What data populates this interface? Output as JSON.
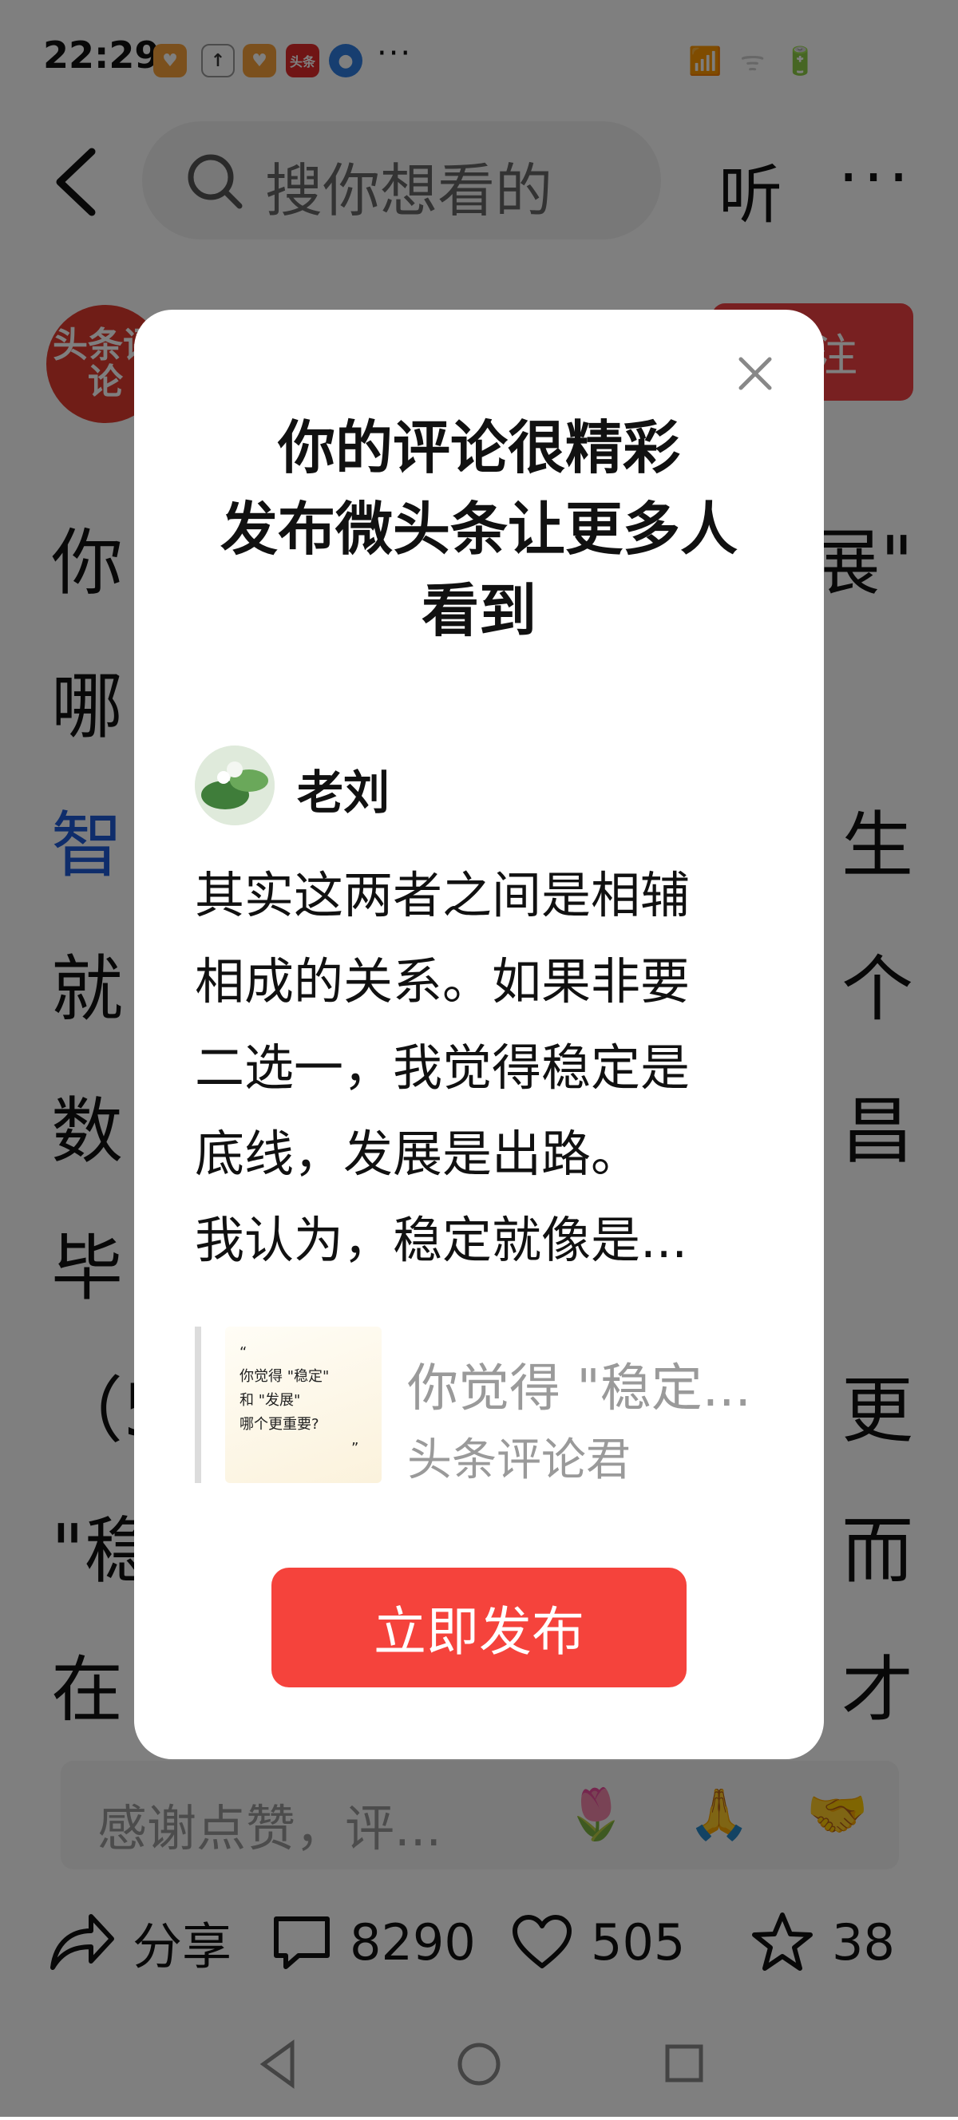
{
  "status_bar": {
    "time": "22:29",
    "more": "···",
    "right_text": "📶 ᯤ 🔋"
  },
  "nav": {
    "search_placeholder": "搜你想看的",
    "listen_label": "听",
    "more_label": "···"
  },
  "article": {
    "author_avatar_text": "头条评论",
    "follow_label": "关注",
    "lines": [
      {
        "left": "你",
        "right": "展\""
      },
      {
        "left": "哪",
        "right": ""
      },
      {
        "left": "智",
        "right": "生"
      },
      {
        "left": "就",
        "right": "个"
      },
      {
        "left": "数",
        "right": "昌"
      },
      {
        "left": "毕",
        "right": ""
      },
      {
        "left": "（5",
        "right": "更"
      },
      {
        "left": "\"稳",
        "right": "而"
      },
      {
        "left": "在",
        "right": "才"
      }
    ]
  },
  "comment_bar": {
    "placeholder": "感谢点赞，评...",
    "emojis": [
      "🌷",
      "🙏",
      "🤝"
    ]
  },
  "actions": {
    "share_label": "分享",
    "comments_count": "8290",
    "likes_count": "505",
    "favorites_count": "38"
  },
  "modal": {
    "title_lines": [
      "你的评论很精彩",
      "发布微头条让更多人",
      "看到"
    ],
    "commenter_name": "老刘",
    "comment_lines": [
      "其实这两者之间是相辅",
      "相成的关系。如果非要",
      "二选一，我觉得稳定是",
      "底线，发展是出路。",
      "我认为，稳定就像是..."
    ],
    "quote": {
      "thumb_lines": [
        "“",
        "你觉得 \"稳定\"",
        "和 \"发展\"",
        "哪个更重要?",
        "”"
      ],
      "title": "你觉得 \"稳定...",
      "source": "头条评论君"
    },
    "publish_label": "立即发布"
  },
  "colors": {
    "accent_red": "#f5433c",
    "link_blue": "#1e5bd6",
    "overlay": "rgba(0,0,0,0.5)"
  }
}
